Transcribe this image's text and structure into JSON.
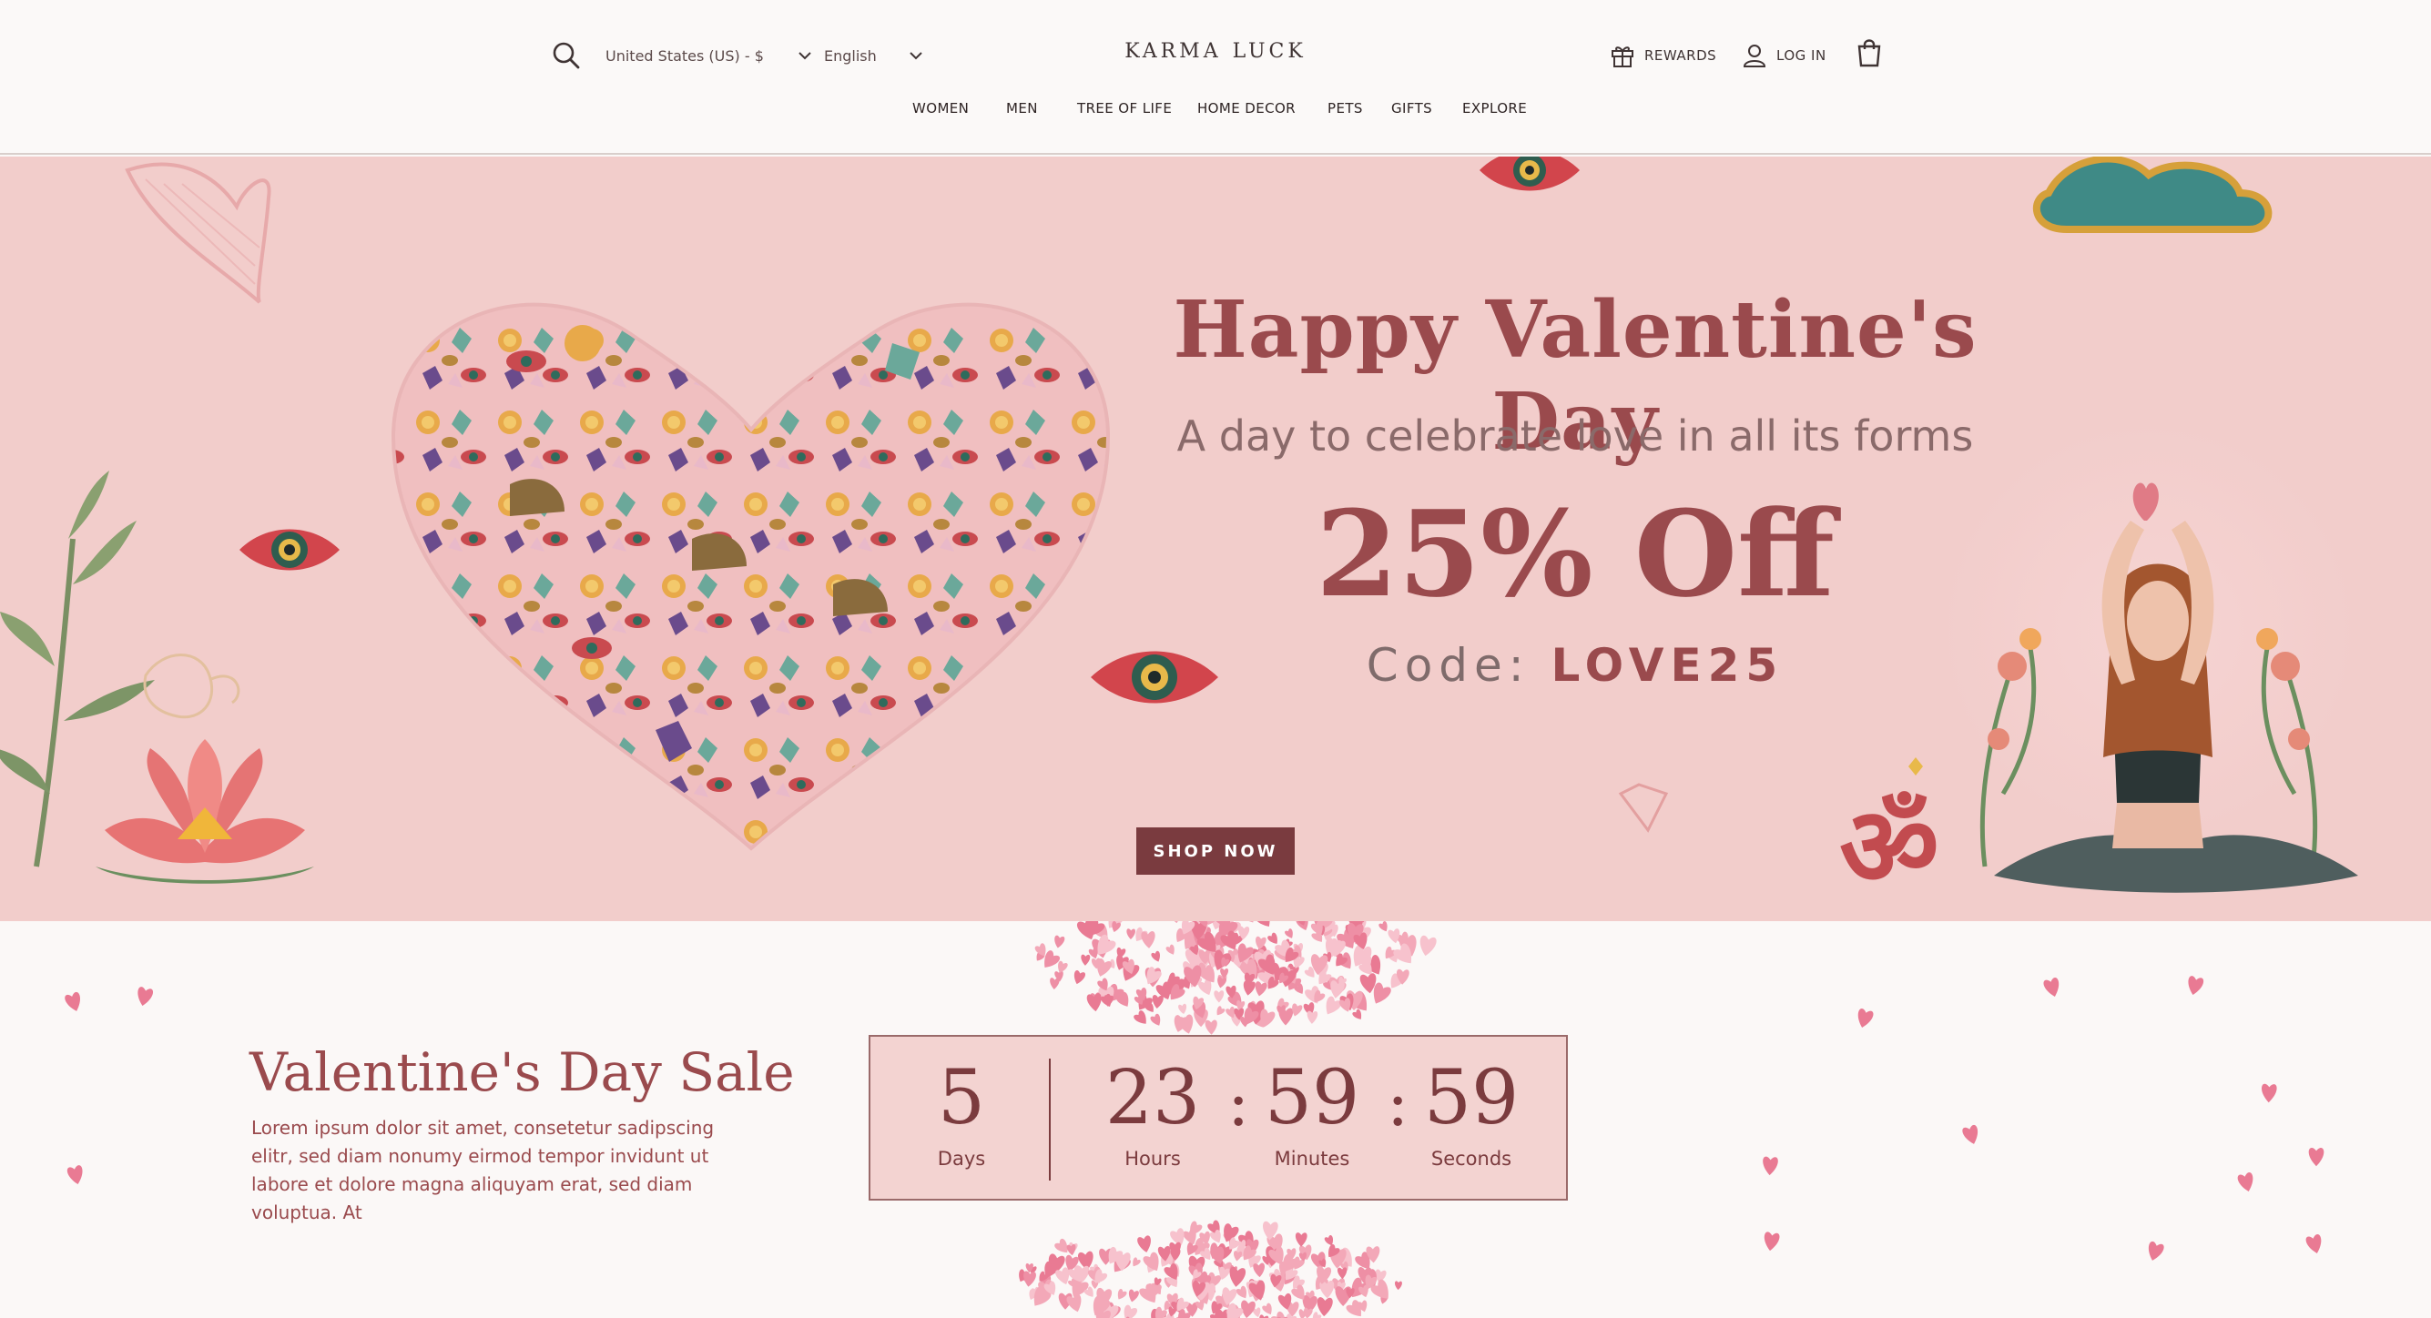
{
  "header": {
    "country_select": "United States (US) - $",
    "language_select": "English",
    "logo_left": "KARMA",
    "logo_right": "LUCK",
    "rewards": "REWARDS",
    "login": "LOG IN",
    "nav": [
      "WOMEN",
      "MEN",
      "TREE OF LIFE",
      "HOME DECOR",
      "PETS",
      "GIFTS",
      "EXPLORE"
    ]
  },
  "hero": {
    "title": "Happy Valentine's Day",
    "subtitle": "A day to celebrate love in all its forms",
    "discount": "25% Off",
    "code_label": "Code:",
    "code_value": "LOVE25",
    "cta": "SHOP NOW"
  },
  "sale": {
    "title": "Valentine's Day Sale",
    "body": "Lorem ipsum dolor sit amet, consetetur sadipscing elitr, sed diam nonumy eirmod tempor invidunt ut labore et dolore magna aliquyam erat, sed diam voluptua. At",
    "countdown": {
      "days": "5",
      "days_label": "Days",
      "hours": "23",
      "hours_label": "Hours",
      "minutes": "59",
      "minutes_label": "Minutes",
      "seconds": "59",
      "seconds_label": "Seconds",
      "separator": ":"
    }
  },
  "colors": {
    "hero_bg": "#f2cdcb",
    "accent": "#9a4a4d",
    "button": "#7a3b3f",
    "countdown_bg": "#f3d3d1"
  },
  "icons": [
    "search-icon",
    "chevron-down-icon",
    "gift-icon",
    "user-icon",
    "shopping-bag-icon",
    "hamsa-logo-icon"
  ]
}
